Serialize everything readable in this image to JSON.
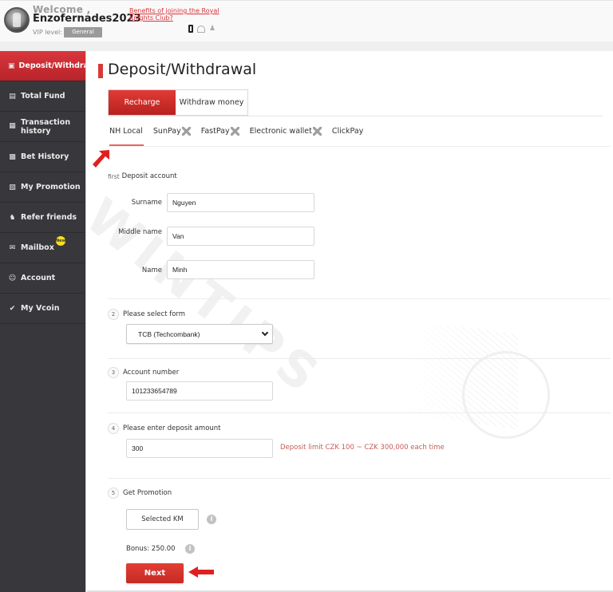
{
  "header": {
    "welcome": "Welcome ,",
    "username": "Enzofernades2023",
    "vip_label": "VIP level:",
    "vip_level": "General",
    "benefits_link": "Benefits of joining the Royal Knights Club?",
    "icons": [
      "phone-icon",
      "mail-icon",
      "user-icon"
    ]
  },
  "sidebar": {
    "items": [
      {
        "label": "Deposit/Withdrawal",
        "icon": "wallet-icon",
        "active": true
      },
      {
        "label": "Total Fund",
        "icon": "fund-icon"
      },
      {
        "label": "Transaction history",
        "icon": "transaction-icon"
      },
      {
        "label": "Bet History",
        "icon": "bet-history-icon"
      },
      {
        "label": "My Promotion",
        "icon": "promotion-icon"
      },
      {
        "label": "Refer friends",
        "icon": "refer-icon"
      },
      {
        "label": "Mailbox",
        "icon": "mailbox-icon",
        "badge": "New"
      },
      {
        "label": "Account",
        "icon": "account-icon"
      },
      {
        "label": "My Vcoin",
        "icon": "vcoin-icon"
      }
    ]
  },
  "main": {
    "title": "Deposit/Withdrawal",
    "tabs": [
      {
        "label": "Recharge",
        "active": true
      },
      {
        "label": "Withdraw money",
        "active": false
      }
    ],
    "pay_methods": [
      {
        "label": "NH Local",
        "active": true,
        "qr": false
      },
      {
        "label": "SunPay",
        "qr": true
      },
      {
        "label": "FastPay",
        "qr": true
      },
      {
        "label": "Electronic wallet",
        "qr": true
      },
      {
        "label": "ClickPay",
        "qr": false
      }
    ],
    "watermark": "WINTIPS",
    "section1": {
      "step": "first",
      "title": "Deposit account",
      "fields": [
        {
          "label": "Surname",
          "value": "Nguyen"
        },
        {
          "label": "Middle name",
          "value": "Van"
        },
        {
          "label": "Name",
          "value": "Minh"
        }
      ]
    },
    "section2": {
      "step": "2",
      "title": "Please select form",
      "selected": "TCB (Techcombank)"
    },
    "section3": {
      "step": "3",
      "title": "Account number",
      "value": "101233654789"
    },
    "section4": {
      "step": "4",
      "title": "Please enter deposit amount",
      "value": "300",
      "limit": "Deposit limit CZK 100 ~ CZK 300,000 each time"
    },
    "section5": {
      "step": "5",
      "title": "Get Promotion",
      "button": "Selected KM",
      "bonus": "Bonus:  250.00"
    },
    "next_button": "Next"
  },
  "colors": {
    "accent": "#d73a36",
    "sidebar_bg": "#38383c",
    "limit_text": "#c85b57"
  }
}
